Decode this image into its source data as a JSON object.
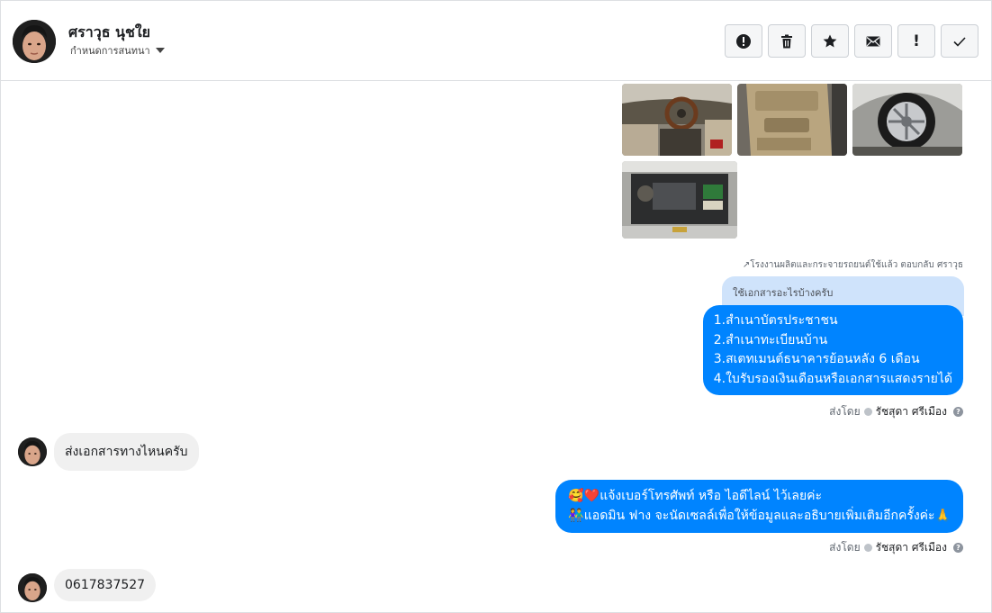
{
  "header": {
    "contact_name": "ศราวุธ นุชใย",
    "assign_label": "กำหนดการสนทนา",
    "tools": [
      {
        "name": "report-spam-button",
        "icon": "alert-circle-icon"
      },
      {
        "name": "delete-button",
        "icon": "trash-icon"
      },
      {
        "name": "star-button",
        "icon": "star-icon"
      },
      {
        "name": "mark-unread-button",
        "icon": "envelope-icon"
      },
      {
        "name": "flag-button",
        "icon": "exclamation-icon",
        "glyph": "!"
      },
      {
        "name": "mark-done-button",
        "icon": "checkmark-icon"
      }
    ]
  },
  "photos": [
    {
      "name": "car-interior-dashboard-photo",
      "icon": "photo"
    },
    {
      "name": "car-door-panel-photo",
      "icon": "photo"
    },
    {
      "name": "car-wheel-photo",
      "icon": "photo"
    },
    {
      "name": "car-engine-photo",
      "icon": "photo"
    }
  ],
  "reply_meta": "↗โรงงานผลิตและกระจายรถยนต์ใช้แล้ว ตอบกลับ ศราวุธ",
  "quoted_message": "ใช้เอกสารอะไรบ้างครับ",
  "messages": {
    "docs_reply": {
      "lines": [
        "1.สำเนาบัตรประชาชน",
        "2.สำเนาทะเบียนบ้าน",
        "3.สเตทเมนต์ธนาคารย้อนหลัง 6 เดือน",
        "4.ใบรับรองเงินเดือนหรือเอกสารแสดงรายได้"
      ]
    },
    "sent_by_label": "ส่งโดย",
    "agent_name": "รัชสุดา ศรีเมือง",
    "incoming_1": "ส่งเอกสารทางไหนครับ",
    "contact_reply": {
      "lines": [
        "🥰❤️แจ้งเบอร์โทรศัพท์ หรือ ไอดีไลน์  ไว้เลยค่ะ",
        "👫แอดมิน ฟาง จะนัดเซลล์เพื่อให้ข้อมูลและอธิบายเพิ่มเติมอีกครั้งค่ะ🙏"
      ]
    },
    "incoming_2": "0617837527"
  },
  "colors": {
    "outgoing": "#0084ff",
    "incoming": "#f0f0f0",
    "quoted": "#cfe3fb"
  }
}
